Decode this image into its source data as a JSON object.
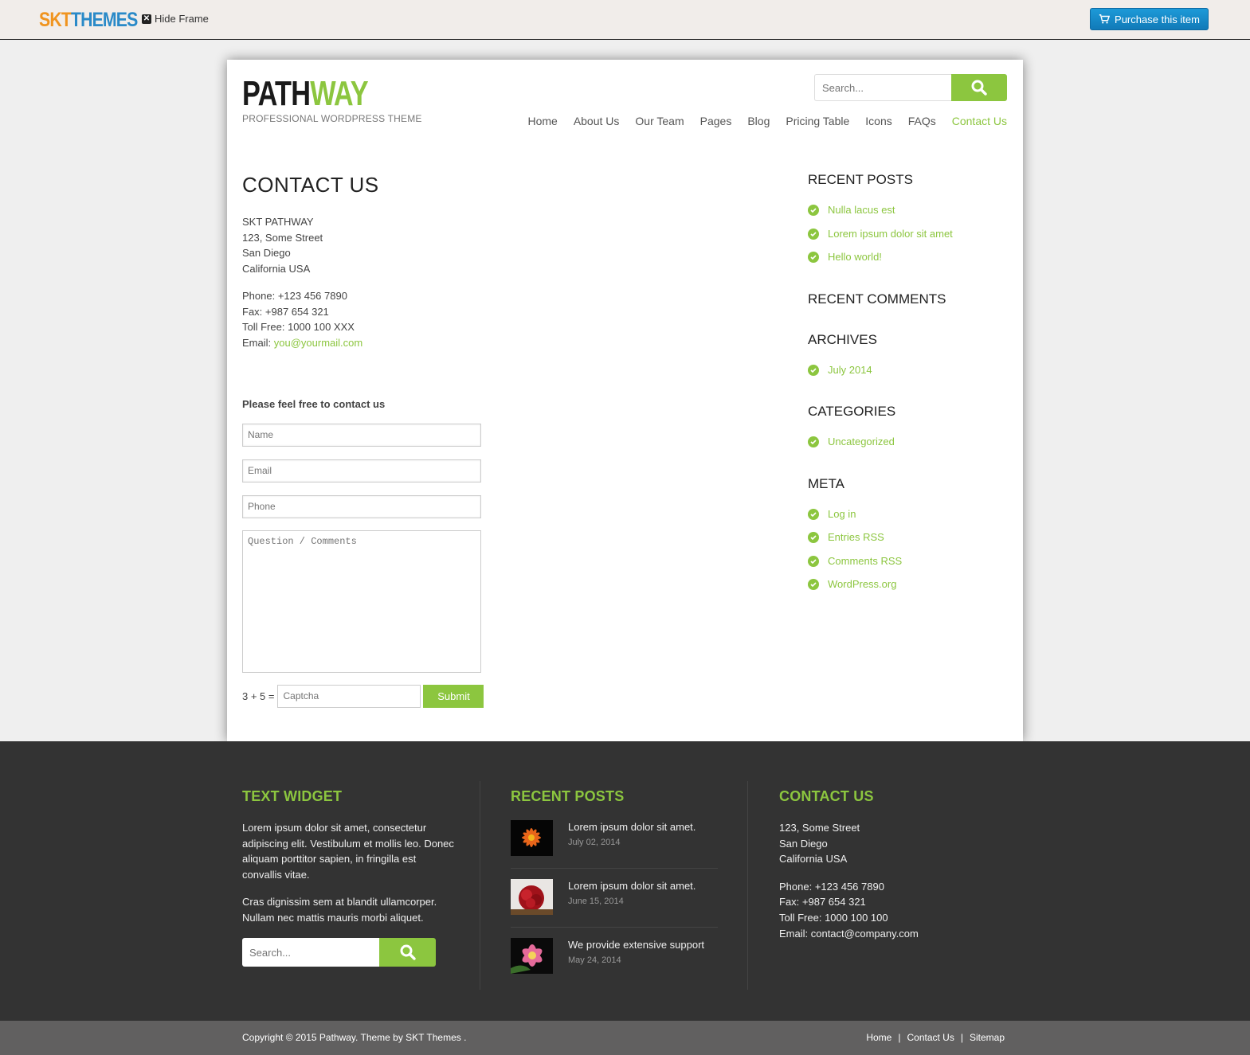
{
  "frame": {
    "brand_part1": "SKT",
    "brand_part2": "THEMES",
    "hide_frame_label": "Hide Frame",
    "purchase_label": "Purchase this item"
  },
  "header": {
    "logo_part1": "PATH",
    "logo_part2": "WAY",
    "tagline": "PROFESSIONAL WORDPRESS THEME",
    "search_placeholder": "Search...",
    "nav": [
      "Home",
      "About Us",
      "Our Team",
      "Pages",
      "Blog",
      "Pricing Table",
      "Icons",
      "FAQs",
      "Contact Us"
    ],
    "active_nav": "Contact Us"
  },
  "main": {
    "title": "CONTACT US",
    "address": [
      "SKT PATHWAY",
      "123, Some Street",
      "San Diego",
      "California USA"
    ],
    "phone": "Phone: +123 456 7890",
    "fax": "Fax: +987 654 321",
    "toll_free": "Toll Free: 1000 100 XXX",
    "email_label": "Email:",
    "email": "you@yourmail.com",
    "form_heading": "Please feel free to contact us",
    "name_placeholder": "Name",
    "email_placeholder": "Email",
    "phone_placeholder": "Phone",
    "comments_placeholder": "Question / Comments",
    "captcha_question": "3 + 5 =",
    "captcha_placeholder": "Captcha",
    "submit_label": "Submit"
  },
  "sidebar": {
    "recent_posts_title": "RECENT POSTS",
    "recent_posts": [
      "Nulla lacus est",
      "Lorem ipsum dolor sit amet",
      "Hello world!"
    ],
    "recent_comments_title": "RECENT COMMENTS",
    "archives_title": "ARCHIVES",
    "archives": [
      "July 2014"
    ],
    "categories_title": "CATEGORIES",
    "categories": [
      "Uncategorized"
    ],
    "meta_title": "META",
    "meta": [
      "Log in",
      "Entries RSS",
      "Comments RSS",
      "WordPress.org"
    ]
  },
  "footer": {
    "text_widget_title": "TEXT WIDGET",
    "text_p1": "Lorem ipsum dolor sit amet, consectetur adipiscing elit. Vestibulum et mollis leo. Donec aliquam porttitor sapien, in fringilla est convallis vitae.",
    "text_p2": "Cras dignissim sem at blandit ullamcorper. Nullam nec mattis mauris morbi aliquet.",
    "search_placeholder": "Search...",
    "recent_posts_title": "RECENT POSTS",
    "posts": [
      {
        "title": "Lorem ipsum dolor sit amet.",
        "date": "July 02, 2014"
      },
      {
        "title": "Lorem ipsum dolor sit amet.",
        "date": "June 15, 2014"
      },
      {
        "title": "We provide extensive support",
        "date": "May 24, 2014"
      }
    ],
    "contact_title": "CONTACT US",
    "contact_address": [
      "123, Some Street",
      "San Diego",
      "California USA"
    ],
    "contact_phone": "Phone: +123 456 7890",
    "contact_fax": "Fax: +987 654 321",
    "contact_toll": "Toll Free: 1000 100 100",
    "contact_email": "Email: contact@company.com"
  },
  "bottom": {
    "copyright": "Copyright © 2015 Pathway. Theme by  SKT Themes .",
    "links": [
      "Home",
      "Contact Us",
      "Sitemap"
    ],
    "separator": "|"
  },
  "colors": {
    "accent": "#8cc63f",
    "footer_bg": "#333333",
    "bottom_bg": "#616060",
    "purchase_blue": "#1d9ad8"
  },
  "icons": [
    "close-icon",
    "cart-icon",
    "search-icon",
    "check-circle-icon"
  ]
}
